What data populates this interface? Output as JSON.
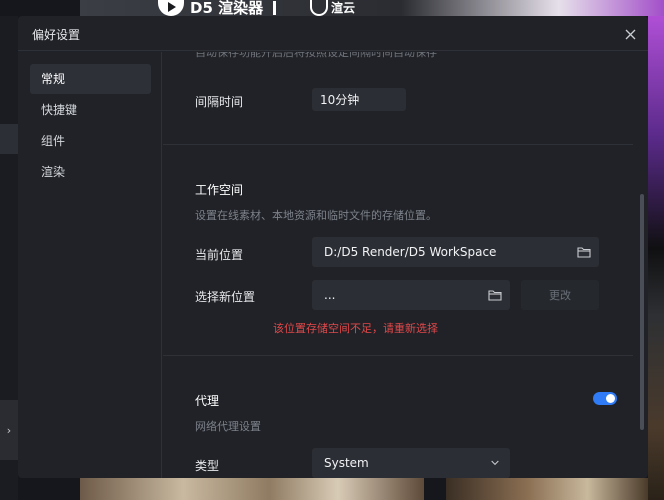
{
  "background": {
    "banner_brand": "D5 渲染器",
    "banner_partner": "渲云",
    "expander_glyph": "›"
  },
  "dialog": {
    "title": "偏好设置",
    "close_icon": "close-icon"
  },
  "sidebar": {
    "items": [
      {
        "label": "常规",
        "active": true
      },
      {
        "label": "快捷键",
        "active": false
      },
      {
        "label": "组件",
        "active": false
      },
      {
        "label": "渲染",
        "active": false
      }
    ]
  },
  "general": {
    "cutoff_text": "自动保存功能开启后将按照设定间隔时间自动保存",
    "interval_label": "间隔时间",
    "interval_value": "10分钟"
  },
  "workspace": {
    "title": "工作空间",
    "description": "设置在线素材、本地资源和临时文件的存储位置。",
    "current_label": "当前位置",
    "current_path": "D:/D5 Render/D5 WorkSpace",
    "new_label": "选择新位置",
    "new_path": "...",
    "change_button": "更改",
    "error": "该位置存储空间不足，请重新选择",
    "folder_icon": "folder-icon"
  },
  "proxy": {
    "title": "代理",
    "description": "网络代理设置",
    "enabled": true,
    "type_label": "类型",
    "type_value": "System",
    "dropdown_icon": "chevron-down-icon"
  },
  "colors": {
    "accent": "#2f7cf6",
    "error": "#e0484a",
    "dialog_bg": "#202227",
    "field_bg": "#2b2e34"
  }
}
